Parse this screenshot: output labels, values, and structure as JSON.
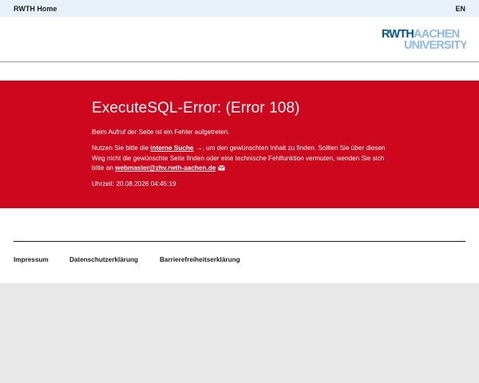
{
  "topbar": {
    "home_label": "RWTH Home",
    "lang_label": "EN"
  },
  "logo": {
    "line1_bold": "RWTH",
    "line1_rest": "AACHEN",
    "line2": "UNIVERSITY",
    "icon": "rwth-logo"
  },
  "error": {
    "title": "ExecuteSQL-Error: (Error 108)",
    "message": "Beim Aufruf der Seite ist ein Fehler aufgetreten.",
    "help_prefix": "Nutzen Sie bitte die ",
    "search_link": "interne Suche",
    "help_middle": ", um den gewünschten Inhalt zu finden. Sollten Sie über diesen Weg nicht die gewünschte Seite finden oder eine technische Fehlfunktion vermuten, wenden Sie sich bitte an ",
    "email_link": "webmaster@zhv.rwth-aachen.de",
    "time_text": "Uhrzeit: 20.08.2026 04:45:19",
    "arrow_icon": "arrow-right-icon",
    "mail_icon": "mail-icon"
  },
  "footer": {
    "links": [
      "Impressum",
      "Datenschutzerklärung",
      "Barrierefreiheitserklärung"
    ]
  },
  "colors": {
    "rwth_red": "#cc071e",
    "rwth_blue": "#00549f",
    "rwth_light_blue": "#8ebae5",
    "topbar_bg": "#e8f1fa"
  }
}
